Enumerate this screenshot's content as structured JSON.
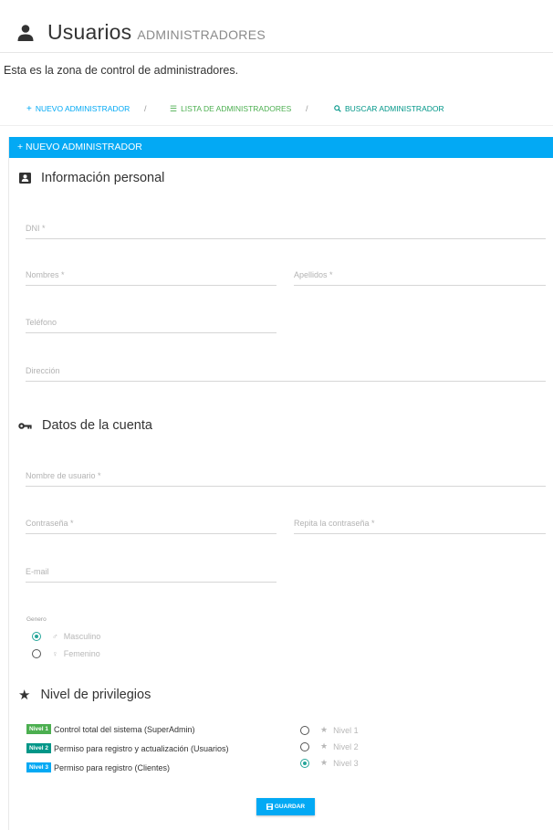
{
  "header": {
    "title": "Usuarios",
    "subtitle": "ADMINISTRADORES",
    "intro": "Esta es la zona de control de administradores."
  },
  "nav": {
    "items": [
      {
        "icon": "plus-icon",
        "label": "NUEVO ADMINISTRADOR",
        "color": "#03a9f4"
      },
      {
        "icon": "list-icon",
        "label": "LISTA DE ADMINISTRADORES",
        "color": "#4caf50"
      },
      {
        "icon": "search-icon",
        "label": "BUSCAR ADMINISTRADOR",
        "color": "#009688"
      }
    ],
    "separator": "/"
  },
  "panel": {
    "heading": "+  NUEVO ADMINISTRADOR",
    "accent": "#03a9f4"
  },
  "personal": {
    "title": "Información personal",
    "icon": "id-card-icon",
    "dni": "DNI *",
    "nombres": "Nombres *",
    "apellidos": "Apellidos *",
    "telefono": "Teléfono",
    "direccion": "Dirección"
  },
  "account": {
    "title": "Datos de la cuenta",
    "icon": "key-icon",
    "usuario": "Nombre de usuario *",
    "password": "Contraseña *",
    "password_repeat": "Repita la contraseña *",
    "email": "E-mail",
    "gender_label": "Genero",
    "gender_options": [
      {
        "label": "Masculino",
        "icon": "male-icon",
        "checked": true
      },
      {
        "label": "Femenino",
        "icon": "female-icon",
        "checked": false
      }
    ]
  },
  "privileges": {
    "title": "Nivel de privilegios",
    "icon": "star-icon",
    "levels": [
      {
        "badge": "Nivel 1",
        "text": "Control total del sistema (SuperAdmin)",
        "color": "#4caf50"
      },
      {
        "badge": "Nivel 2",
        "text": "Permiso para registro y actualización (Usuarios)",
        "color": "#009688"
      },
      {
        "badge": "Nivel 3",
        "text": "Permiso para registro (Clientes)",
        "color": "#03a9f4"
      }
    ],
    "options": [
      {
        "label": "Nivel 1",
        "checked": false
      },
      {
        "label": "Nivel 2",
        "checked": false
      },
      {
        "label": "Nivel 3",
        "checked": true
      }
    ]
  },
  "actions": {
    "save_label": "GUARDAR"
  }
}
